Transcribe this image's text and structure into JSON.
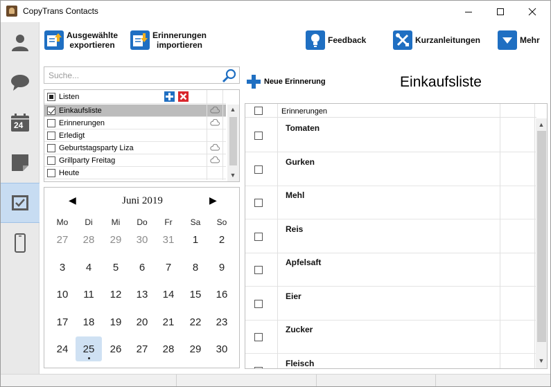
{
  "window": {
    "title": "CopyTrans Contacts",
    "minimize": "—",
    "maximize": "☐",
    "close": "✕"
  },
  "sidebar": {
    "items": [
      {
        "name": "contacts",
        "icon": "person-icon"
      },
      {
        "name": "messages",
        "icon": "chat-bubble-icon"
      },
      {
        "name": "calendar",
        "icon": "calendar-icon",
        "text": "24"
      },
      {
        "name": "notes",
        "icon": "note-icon"
      },
      {
        "name": "reminders",
        "icon": "reminder-check-icon",
        "active": true
      },
      {
        "name": "device",
        "icon": "phone-icon"
      }
    ]
  },
  "toolbar": {
    "export_line1": "Ausgewählte",
    "export_line2": "exportieren",
    "import_line1": "Erinnerungen",
    "import_line2": "importieren",
    "feedback": "Feedback",
    "guides": "Kurzanleitungen",
    "more": "Mehr"
  },
  "search": {
    "placeholder": "Suche..."
  },
  "lists": {
    "header": "Listen",
    "items": [
      {
        "label": "Einkaufsliste",
        "checked": true,
        "cloud": true,
        "selected": true
      },
      {
        "label": "Erinnerungen",
        "checked": false,
        "cloud": true
      },
      {
        "label": "Erledigt",
        "checked": false,
        "cloud": false
      },
      {
        "label": "Geburtstagsparty Liza",
        "checked": false,
        "cloud": true
      },
      {
        "label": "Grillparty Freitag",
        "checked": false,
        "cloud": true
      },
      {
        "label": "Heute",
        "checked": false,
        "cloud": false
      }
    ]
  },
  "calendar": {
    "month": "Juni 2019",
    "weekdays": [
      "Mo",
      "Di",
      "Mi",
      "Do",
      "Fr",
      "Sa",
      "So"
    ],
    "weeks": [
      [
        "27",
        "28",
        "29",
        "30",
        "31",
        "1",
        "2"
      ],
      [
        "3",
        "4",
        "5",
        "6",
        "7",
        "8",
        "9"
      ],
      [
        "10",
        "11",
        "12",
        "13",
        "14",
        "15",
        "16"
      ],
      [
        "17",
        "18",
        "19",
        "20",
        "21",
        "22",
        "23"
      ],
      [
        "24",
        "25",
        "26",
        "27",
        "28",
        "29",
        "30"
      ]
    ],
    "muted_first_row_count": 5,
    "today": "25"
  },
  "main": {
    "new_reminder": "Neue Erinnerung",
    "list_title": "Einkaufsliste",
    "column_header": "Erinnerungen",
    "reminders": [
      "Tomaten",
      "Gurken",
      "Mehl",
      "Reis",
      "Apfelsaft",
      "Eier",
      "Zucker",
      "Fleisch"
    ]
  },
  "colors": {
    "accent": "#1f6fc2",
    "selection": "#bcbcbc",
    "active_sidebar": "#c7dcf2",
    "delete": "#d9262c"
  }
}
